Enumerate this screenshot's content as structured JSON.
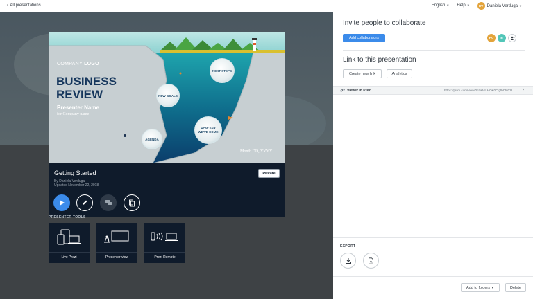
{
  "topbar": {
    "back_label": "All presentations",
    "language": "English",
    "help": "Help",
    "user_initials": "DV",
    "user_name": "Daniela Verduga"
  },
  "slide": {
    "company_logo_regular": "COMPANY ",
    "company_logo_bold": "LOGO",
    "title_line1": "BUSINESS",
    "title_line2": "REVIEW",
    "presenter_name": "Presenter Name",
    "company_name": "for Company name",
    "date": "Month DD, YYYY",
    "bubbles": {
      "next_steps": "NEXT STEPS",
      "new_goals": "NEW GOALS",
      "how_far_line1": "HOW FAR",
      "how_far_line2": "WE'VE COME",
      "agenda": "AGENDA"
    }
  },
  "presentation": {
    "title": "Getting Started",
    "author": "By Daniela Verduga",
    "updated": "Updated November 22, 2018",
    "privacy_label": "Private"
  },
  "presenter_tools": {
    "section_title": "PRESENTER TOOLS",
    "items": [
      {
        "label": "Live Prezi",
        "icon": "devices-icon"
      },
      {
        "label": "Presenter view",
        "icon": "presenter-view-icon"
      },
      {
        "label": "Prezi Remote",
        "icon": "remote-icon"
      }
    ]
  },
  "panel": {
    "invite_title": "Invite people to collaborate",
    "add_collaborators": "Add collaborators",
    "collaborators": [
      {
        "initials": "DV",
        "color": "#e3a43b"
      },
      {
        "initials": "N",
        "color": "#52c6b8"
      }
    ],
    "link_title": "Link to this presentation",
    "create_link": "Create new link",
    "analytics": "Analytics",
    "link_label": "Viewer in Prezi",
    "link_url": "https://prezi.com/view/0n7wHUHOK0CtgthCtuYU",
    "export_title": "EXPORT",
    "add_to_folders": "Add to folders",
    "delete": "Delete"
  },
  "colors": {
    "accent": "#3b8bea",
    "card_bg": "#0f1b2b",
    "title_blue": "#15365c"
  }
}
